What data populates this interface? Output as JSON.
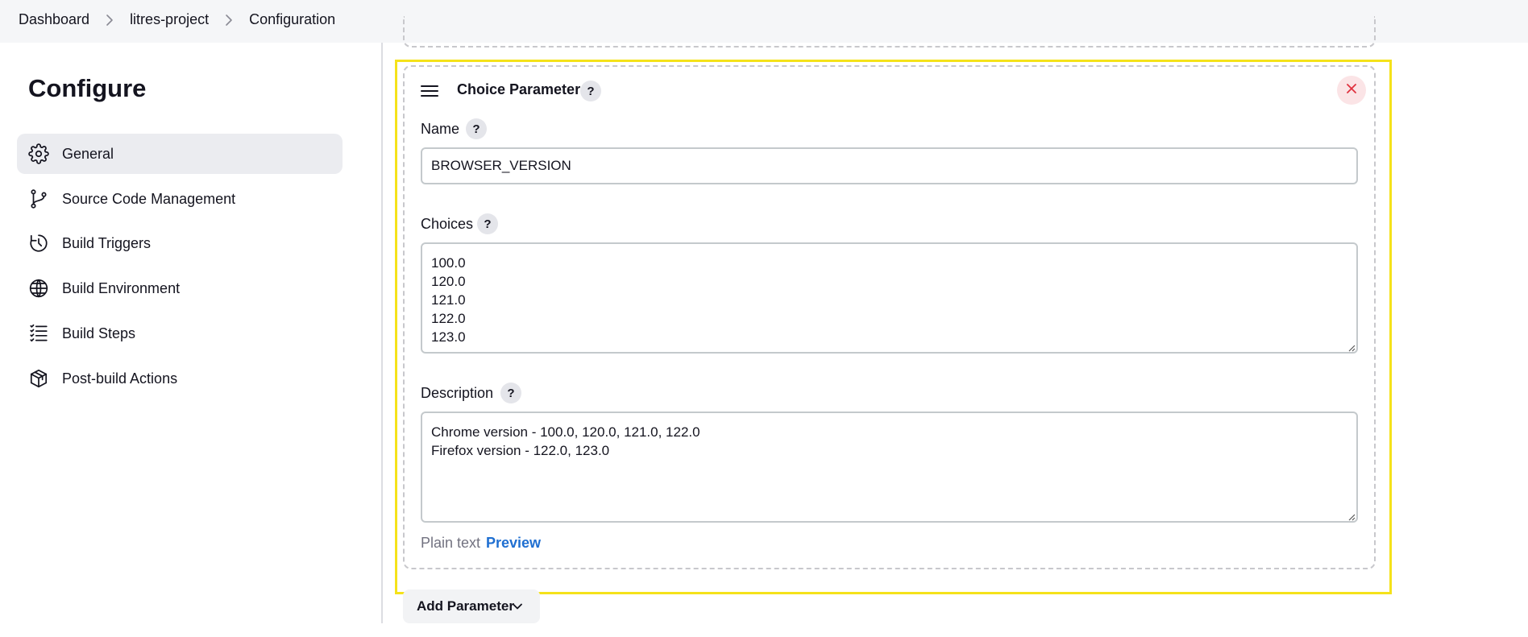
{
  "breadcrumb": {
    "items": [
      "Dashboard",
      "litres-project",
      "Configuration"
    ]
  },
  "sidebar": {
    "title": "Configure",
    "items": [
      {
        "label": "General",
        "icon": "gear-icon",
        "active": true
      },
      {
        "label": "Source Code Management",
        "icon": "git-branch-icon"
      },
      {
        "label": "Build Triggers",
        "icon": "clock-icon"
      },
      {
        "label": "Build Environment",
        "icon": "globe-icon"
      },
      {
        "label": "Build Steps",
        "icon": "list-icon"
      },
      {
        "label": "Post-build Actions",
        "icon": "package-icon"
      }
    ]
  },
  "parameter_card": {
    "title": "Choice Parameter",
    "help_label": "?",
    "close_label": "✕",
    "highlight_color": "#f5e21a",
    "name": {
      "label": "Name",
      "value": "BROWSER_VERSION"
    },
    "choices": {
      "label": "Choices",
      "value": "100.0\n120.0\n121.0\n122.0\n123.0"
    },
    "description": {
      "label": "Description",
      "value": "Chrome version - 100.0, 120.0, 121.0, 122.0\nFirefox version - 122.0, 123.0",
      "format_plain": "Plain text",
      "format_preview": "Preview"
    }
  },
  "add_parameter": {
    "label": "Add Parameter"
  },
  "colors": {
    "accent_link": "#1f6fd1",
    "close_red": "#e0323f",
    "active_item_bg": "#ebecf0"
  }
}
